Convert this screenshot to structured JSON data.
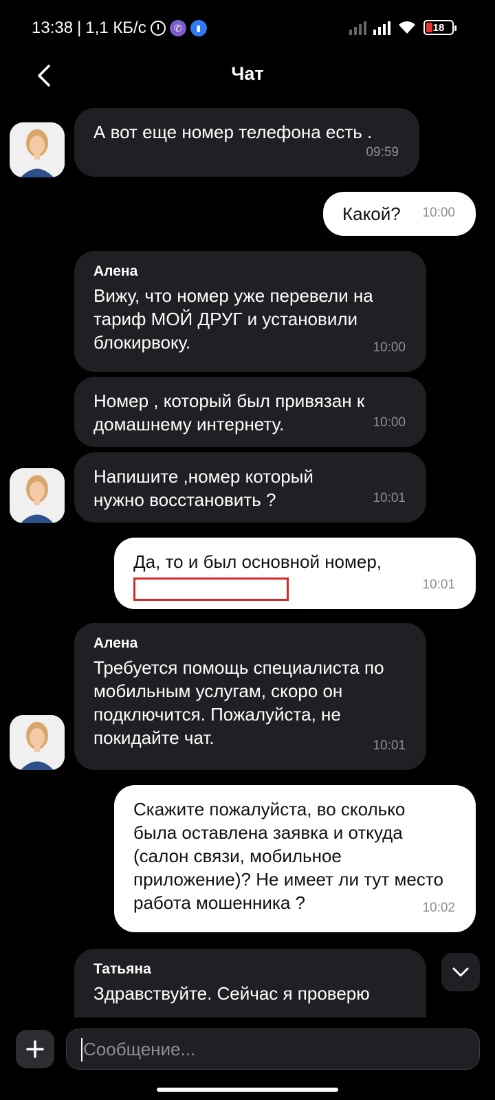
{
  "status_bar": {
    "time": "13:38",
    "separator": "|",
    "speed": "1,1 КБ/с",
    "battery": "18",
    "icons": [
      "alarm-icon",
      "viber-icon",
      "app-icon",
      "signal-icon",
      "wifi-icon",
      "battery-icon"
    ]
  },
  "header": {
    "title": "Чат",
    "back_icon": "chevron-left-icon"
  },
  "messages": [
    {
      "side": "in",
      "sender": "",
      "text": "А вот еще номер телефона есть .",
      "time": "09:59"
    },
    {
      "side": "out",
      "text": "Какой?",
      "time": "10:00"
    },
    {
      "side": "in",
      "sender": "Алена",
      "text": "Вижу, что номер уже перевели на тариф МОЙ ДРУГ и установили блокирвоку.",
      "time": "10:00"
    },
    {
      "side": "in",
      "sender": "",
      "text": "Номер , который был привязан к домашнему интернету.",
      "time": "10:00"
    },
    {
      "side": "in",
      "sender": "",
      "text": "Напишите ,номер который нужно восстановить ?",
      "time": "10:01"
    },
    {
      "side": "out",
      "text": "Да, то и был основной номер,",
      "time": "10:01"
    },
    {
      "side": "in",
      "sender": "Алена",
      "text": "Требуется помощь специалиста по мобильным услугам, скоро он подключится. Пожалуйста, не покидайте чат.",
      "time": "10:01"
    },
    {
      "side": "out",
      "text": "Скажите пожалуйста, во сколько была оставлена заявка и откуда (салон связи, мобильное приложение)? Не имеет ли тут место работа мошенника ?",
      "time": "10:02"
    },
    {
      "side": "in",
      "sender": "Татьяна",
      "text": "Здравствуйте. Сейчас я проверю",
      "time": ""
    }
  ],
  "input": {
    "placeholder": "Сообщение..."
  },
  "colors": {
    "background": "#000000",
    "incoming_bubble": "#1f2023",
    "outgoing_bubble": "#ffffff",
    "redaction": "#d62a2a"
  }
}
